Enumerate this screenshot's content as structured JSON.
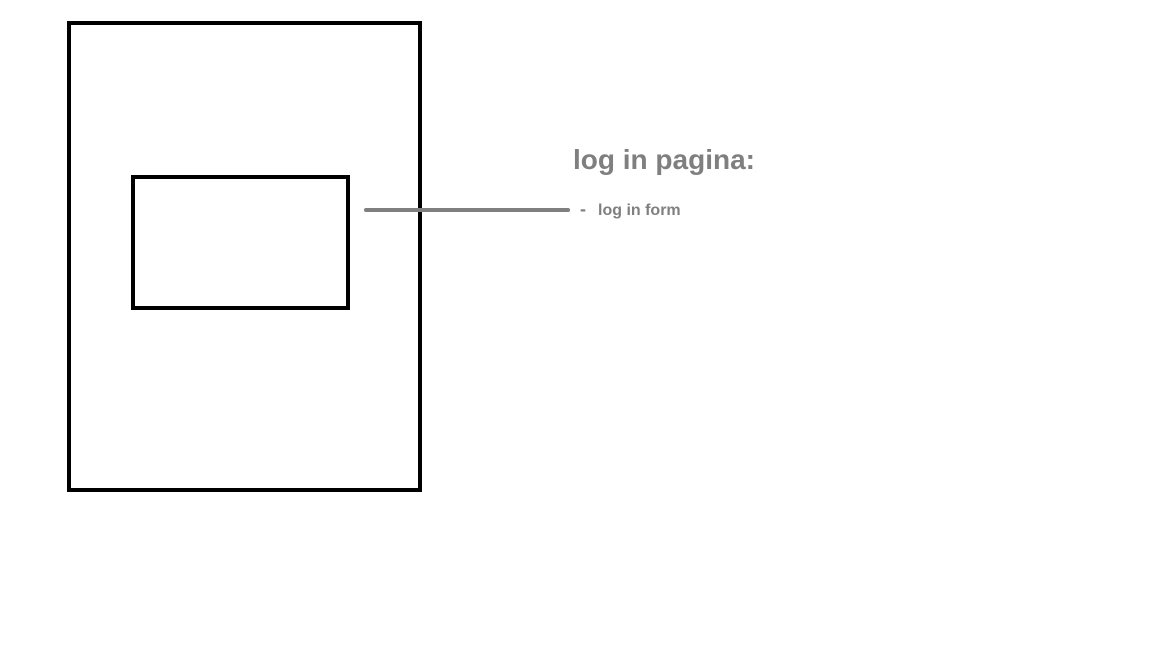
{
  "colors": {
    "outline": "#000000",
    "annotation": "#7f7f7f"
  },
  "annotation": {
    "title": "log in pagina:",
    "items": [
      {
        "bullet": "-",
        "label": "log in form"
      }
    ]
  }
}
